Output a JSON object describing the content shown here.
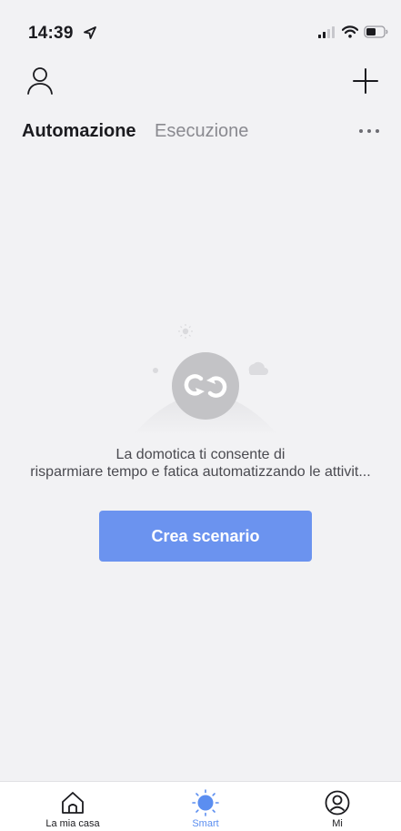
{
  "status_bar": {
    "time": "14:39",
    "icons": [
      "location-arrow-icon",
      "cellular-signal-icon",
      "wifi-icon",
      "battery-icon"
    ]
  },
  "top_bar": {
    "icons": [
      "profile-icon",
      "plus-icon"
    ]
  },
  "tabs": [
    {
      "label": "Automazione",
      "active": true
    },
    {
      "label": "Esecuzione",
      "active": false
    }
  ],
  "more_icon": "ellipsis-icon",
  "empty_state": {
    "illustration": "automation-loop-icon",
    "message_line1": "La domotica ti consente di",
    "message_line2": "risparmiare tempo e fatica automatizzando le attivit...",
    "button_label": "Crea scenario"
  },
  "bottom_nav": [
    {
      "label": "La mia casa",
      "icon": "home-icon",
      "active": false
    },
    {
      "label": "Smart",
      "icon": "sun-icon",
      "active": true
    },
    {
      "label": "Mi",
      "icon": "user-circle-icon",
      "active": false
    }
  ],
  "colors": {
    "background": "#f2f2f4",
    "accent": "#6b93ef",
    "active_nav": "#5b8ef0",
    "inactive_tab": "#8a8a90"
  }
}
